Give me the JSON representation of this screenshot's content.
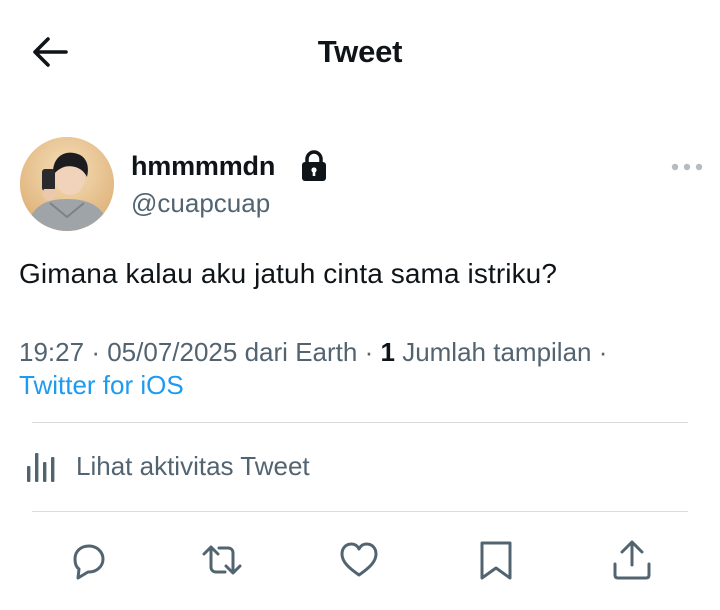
{
  "header": {
    "title": "Tweet",
    "back_icon": "arrow-left-icon"
  },
  "author": {
    "display_name": "hmmmmdn",
    "username": "@cuapcuap",
    "protected_icon": "lock-icon",
    "avatar": "profile-photo"
  },
  "tweet": {
    "text": "Gimana kalau aku jatuh cinta sama istriku?",
    "time": "19:27",
    "date": "05/07/2025",
    "location_prefix": "dari",
    "location": "Earth",
    "views_count": "1",
    "views_label": "Jumlah tampilan",
    "separator": "·",
    "client": "Twitter for iOS"
  },
  "activity": {
    "label": "Lihat aktivitas Tweet",
    "icon": "bar-chart-icon"
  },
  "actions": [
    {
      "name": "reply",
      "icon": "reply-icon"
    },
    {
      "name": "retweet",
      "icon": "retweet-icon"
    },
    {
      "name": "like",
      "icon": "heart-icon"
    },
    {
      "name": "bookmark",
      "icon": "bookmark-icon"
    },
    {
      "name": "share",
      "icon": "share-icon"
    }
  ],
  "colors": {
    "text": "#0f1419",
    "secondary": "#536471",
    "link": "#1d9bf0",
    "divider": "#d9dcdf"
  }
}
